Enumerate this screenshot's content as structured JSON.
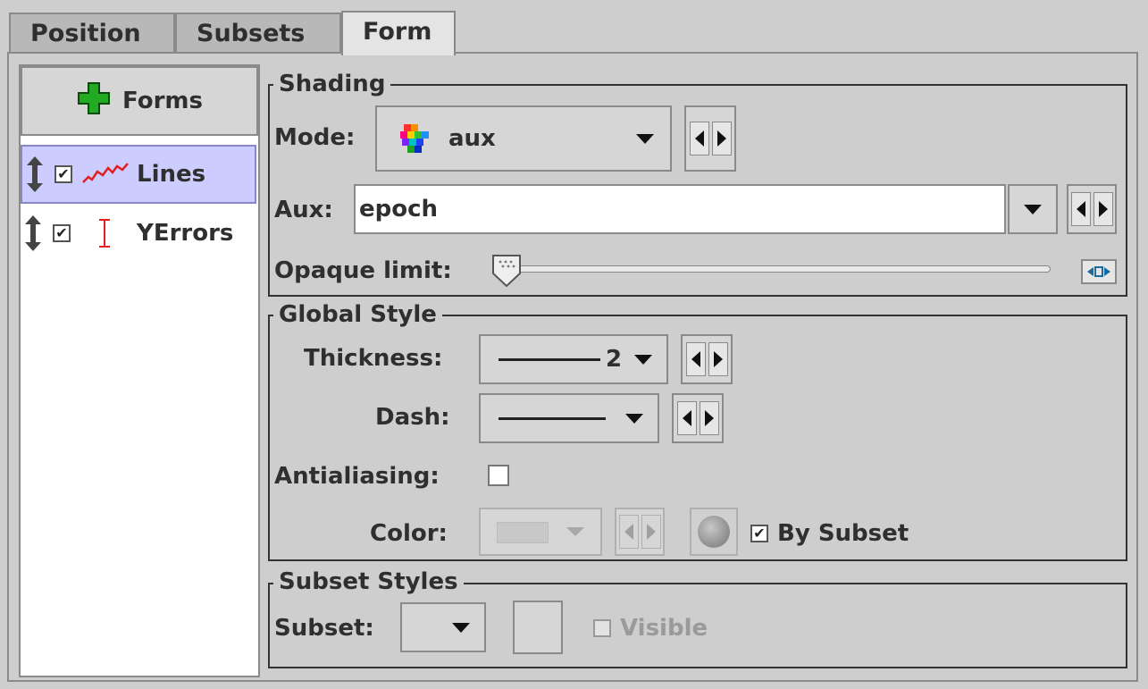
{
  "tabs": [
    {
      "label": "Position"
    },
    {
      "label": "Subsets"
    },
    {
      "label": "Form"
    }
  ],
  "forms_panel": {
    "add_button_label": "Forms",
    "items": [
      {
        "label": "Lines",
        "checked": true,
        "selected": true,
        "icon": "lines-icon"
      },
      {
        "label": "YErrors",
        "checked": true,
        "selected": false,
        "icon": "yerror-bar-icon"
      }
    ]
  },
  "shading": {
    "title": "Shading",
    "mode_label": "Mode:",
    "mode_value": "aux",
    "aux_label": "Aux:",
    "aux_value": "epoch",
    "opaque_label": "Opaque limit:"
  },
  "global_style": {
    "title": "Global Style",
    "thickness_label": "Thickness:",
    "thickness_value": "2",
    "dash_label": "Dash:",
    "antialiasing_label": "Antialiasing:",
    "antialiasing_checked": false,
    "color_label": "Color:",
    "by_subset_label": "By Subset",
    "by_subset_checked": true
  },
  "subset_styles": {
    "title": "Subset Styles",
    "subset_label": "Subset:",
    "visible_label": "Visible",
    "visible_checked": false
  },
  "colors": {
    "background": "#cecece",
    "selection": "#ccccff",
    "plus_green": "#22aa22",
    "line_red": "#e02020"
  }
}
